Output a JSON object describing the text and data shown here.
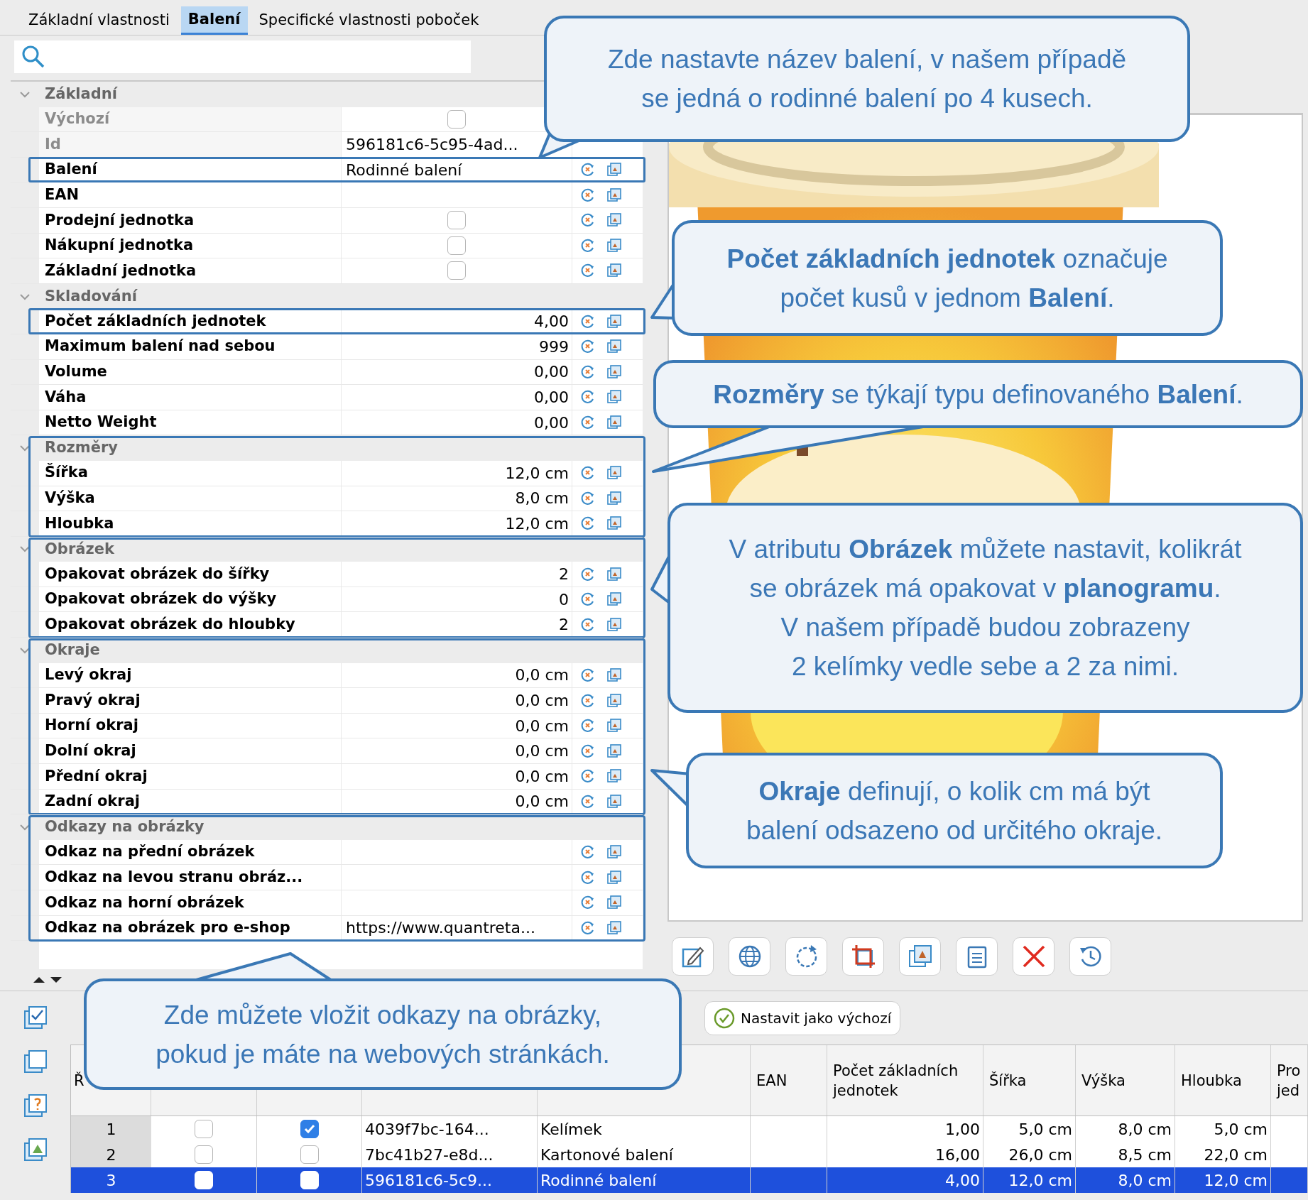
{
  "tabs": [
    {
      "label": "Základní vlastnosti",
      "selected": false
    },
    {
      "label": "Balení",
      "selected": true
    },
    {
      "label": "Specifické vlastnosti poboček",
      "selected": false
    }
  ],
  "properties": [
    {
      "group": "Základní",
      "expanded": true,
      "framed": false,
      "rows": [
        {
          "name": "Výchozí",
          "kind": "checkbox",
          "checked": false,
          "disabled": true,
          "framed": false
        },
        {
          "name": "Id",
          "kind": "text",
          "value": "596181c6-5c95-4ad...",
          "disabled": true,
          "framed": false
        },
        {
          "name": "Balení",
          "kind": "text",
          "value": "Rodinné balení",
          "disabled": false,
          "framed": true
        },
        {
          "name": "EAN",
          "kind": "text",
          "disabled": false,
          "framed": false
        },
        {
          "name": "Prodejní jednotka",
          "kind": "checkbox",
          "checked": false,
          "disabled": false,
          "framed": false
        },
        {
          "name": "Nákupní jednotka",
          "kind": "checkbox",
          "checked": false,
          "disabled": false,
          "framed": false
        },
        {
          "name": "Základní jednotka",
          "kind": "checkbox",
          "checked": false,
          "disabled": false,
          "framed": false
        }
      ]
    },
    {
      "group": "Skladování",
      "expanded": true,
      "framed": false,
      "rows": [
        {
          "name": "Počet základních jednotek",
          "kind": "number",
          "value": "4,00",
          "disabled": false,
          "framed": true
        },
        {
          "name": "Maximum balení nad sebou",
          "kind": "number",
          "value": "999",
          "disabled": false,
          "framed": false
        },
        {
          "name": "Volume",
          "kind": "number",
          "value": "0,00",
          "disabled": false,
          "framed": false
        },
        {
          "name": "Váha",
          "kind": "number",
          "value": "0,00",
          "disabled": false,
          "framed": false
        },
        {
          "name": "Netto Weight",
          "kind": "number",
          "value": "0,00",
          "disabled": false,
          "framed": false
        }
      ]
    },
    {
      "group": "Rozměry",
      "expanded": true,
      "framed": true,
      "rows": [
        {
          "name": "Šířka",
          "kind": "number",
          "value": "12,0 cm",
          "disabled": false,
          "framed": false
        },
        {
          "name": "Výška",
          "kind": "number",
          "value": "8,0 cm",
          "disabled": false,
          "framed": false
        },
        {
          "name": "Hloubka",
          "kind": "number",
          "value": "12,0 cm",
          "disabled": false,
          "framed": false
        }
      ]
    },
    {
      "group": "Obrázek",
      "expanded": true,
      "framed": true,
      "rows": [
        {
          "name": "Opakovat obrázek do šířky",
          "kind": "number",
          "value": "2",
          "disabled": false,
          "framed": false
        },
        {
          "name": "Opakovat obrázek do výšky",
          "kind": "number",
          "value": "0",
          "disabled": false,
          "framed": false
        },
        {
          "name": "Opakovat obrázek do hloubky",
          "kind": "number",
          "value": "2",
          "disabled": false,
          "framed": false
        }
      ]
    },
    {
      "group": "Okraje",
      "expanded": true,
      "framed": true,
      "rows": [
        {
          "name": "Levý okraj",
          "kind": "number",
          "value": "0,0 cm",
          "disabled": false,
          "framed": false
        },
        {
          "name": "Pravý okraj",
          "kind": "number",
          "value": "0,0 cm",
          "disabled": false,
          "framed": false
        },
        {
          "name": "Horní okraj",
          "kind": "number",
          "value": "0,0 cm",
          "disabled": false,
          "framed": false
        },
        {
          "name": "Dolní okraj",
          "kind": "number",
          "value": "0,0 cm",
          "disabled": false,
          "framed": false
        },
        {
          "name": "Přední okraj",
          "kind": "number",
          "value": "0,0 cm",
          "disabled": false,
          "framed": false
        },
        {
          "name": "Zadní okraj",
          "kind": "number",
          "value": "0,0 cm",
          "disabled": false,
          "framed": false
        }
      ]
    },
    {
      "group": "Odkazy na obrázky",
      "expanded": true,
      "framed": true,
      "rows": [
        {
          "name": "Odkaz na přední obrázek",
          "kind": "text",
          "disabled": false,
          "framed": false
        },
        {
          "name": "Odkaz na levou stranu obráz...",
          "kind": "text",
          "disabled": false,
          "framed": false
        },
        {
          "name": "Odkaz na horní obrázek",
          "kind": "text",
          "disabled": false,
          "framed": false
        },
        {
          "name": "Odkaz na obrázek pro e-shop",
          "kind": "text",
          "value": "https://www.quantreta...",
          "disabled": false,
          "framed": false
        }
      ]
    }
  ],
  "set_default_button": "Nastavit jako výchozí",
  "table": {
    "columns": [
      {
        "label": "Ř"
      },
      {},
      {},
      {},
      {},
      {
        "label": "EAN"
      },
      {
        "label": "Počet základních jednotek"
      },
      {
        "label": "Šířka"
      },
      {
        "label": "Výška"
      },
      {
        "label": "Hloubka"
      },
      {
        "label": "Pro jed"
      }
    ],
    "rows": [
      {
        "number": "1",
        "column_2_checked": false,
        "column_3_checked": true,
        "id": "4039f7bc-164...",
        "name": "Kelímek",
        "count": "1,00",
        "width": "5,0 cm",
        "height": "8,0 cm",
        "depth": "5,0 cm",
        "selected": false
      },
      {
        "number": "2",
        "column_2_checked": false,
        "column_3_checked": false,
        "id": "7bc41b27-e8d...",
        "name": "Kartonové balení",
        "count": "16,00",
        "width": "26,0 cm",
        "height": "8,5 cm",
        "depth": "22,0 cm",
        "selected": false
      },
      {
        "number": "3",
        "column_2_checked": false,
        "column_3_checked": false,
        "id": "596181c6-5c9...",
        "name": "Rodinné balení",
        "count": "4,00",
        "width": "12,0 cm",
        "height": "8,0 cm",
        "depth": "12,0 cm",
        "selected": true
      }
    ]
  },
  "callouts": [
    {
      "paragraphs": [
        "Zde nastavte název balení, v našem případě se jedná o rodinné balení po 4 kusech."
      ]
    },
    {
      "paragraphs": [
        "**Počet základních jednotek** označuje počet kusů v jednom **Balení**."
      ]
    },
    {
      "paragraphs": [
        "**Rozměry** se týkají typu definovaného **Balení**."
      ]
    },
    {
      "paragraphs": [
        "V atributu **Obrázek** můžete nastavit, kolikrát se obrázek má opakovat v **planogramu**.",
        "V našem případě budou zobrazeny 2 kelímky vedle sebe a 2 za nimi."
      ]
    },
    {
      "paragraphs": [
        "**Okraje** definují, o kolik cm má být balení odsazeno od určitého okraje."
      ]
    },
    {
      "paragraphs": [
        "Zde můžete vložit odkazy na obrázky, pokud je máte na webových stránkách."
      ]
    }
  ]
}
